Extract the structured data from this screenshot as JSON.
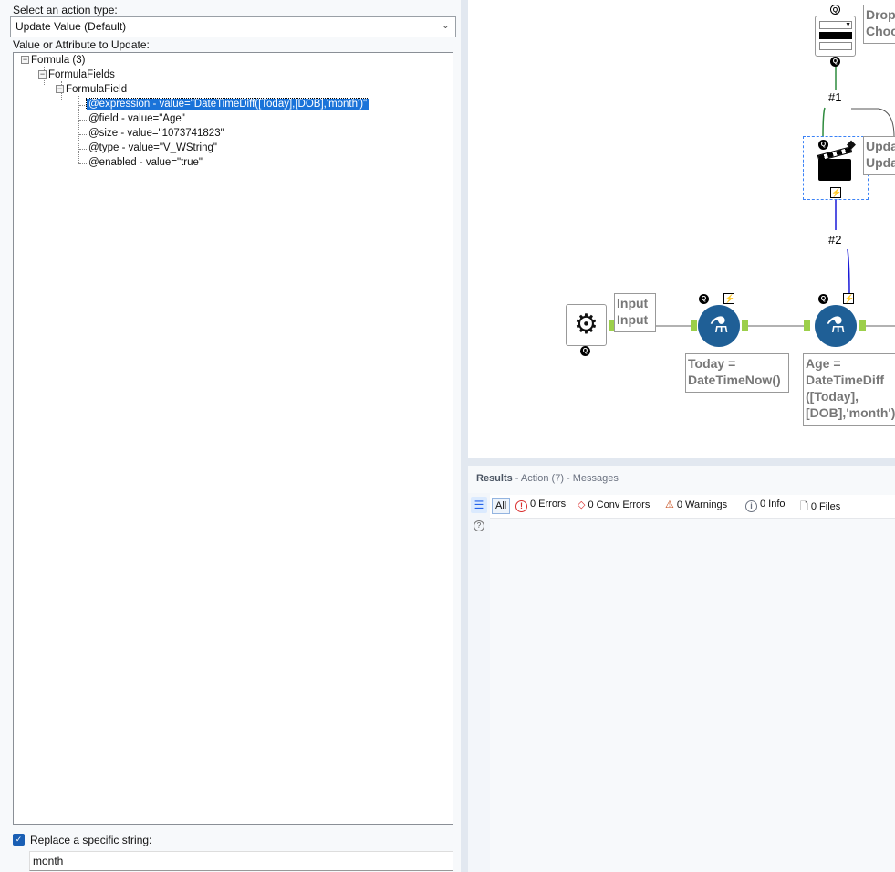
{
  "config": {
    "action_type_label": "Select an action type:",
    "action_type_value": "Update Value (Default)",
    "value_label": "Value or Attribute to Update:",
    "tree": {
      "root": "Formula (3)",
      "child": "FormulaFields",
      "grandchild": "FormulaField",
      "attributes": [
        "@expression - value=\"DateTimeDiff([Today],[DOB],'month')\"",
        "@field - value=\"Age\"",
        "@size - value=\"1073741823\"",
        "@type - value=\"V_WString\"",
        "@enabled - value=\"true\""
      ]
    },
    "replace_checked": true,
    "replace_label": "Replace a specific string:",
    "replace_value": "month"
  },
  "canvas": {
    "dropdown_annotation": "Drop\nChoo",
    "action_annotation": "Upda\nUpda",
    "connection1": "#1",
    "connection2": "#2",
    "input_annotation": "Input\nInput",
    "formula1_annotation": "Today =\nDateTimeNow()",
    "formula2_annotation": "Age =\nDateTimeDiff\n([Today],\n[DOB],'month')",
    "q_badge": "Q",
    "bolt_badge": "⚡"
  },
  "results": {
    "title": "Results",
    "subtitle": " - Action (7) - Messages",
    "filters": {
      "all": "All",
      "errors": "0 Errors",
      "conv_errors": "0 Conv Errors",
      "warnings": "0 Warnings",
      "info": "0 Info",
      "files": "0 Files"
    },
    "colors": {
      "errors": "#d92d2d",
      "warnings": "#c2410c",
      "info": "#6b7280"
    }
  }
}
